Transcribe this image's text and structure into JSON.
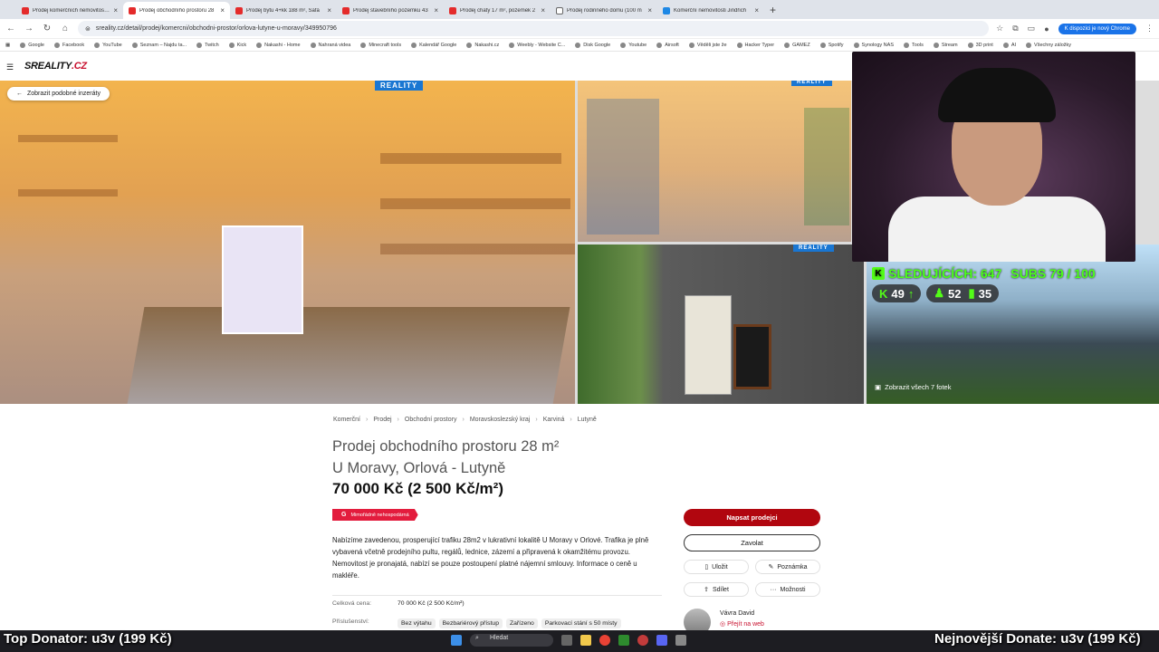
{
  "browser": {
    "tabs": [
      {
        "label": "Prodej komerčních nemovitostí -",
        "active": false,
        "icon": "sreality-favicon"
      },
      {
        "label": "Prodej obchodního prostoru 28",
        "active": true,
        "icon": "sreality-favicon"
      },
      {
        "label": "Prodej bytu 4+kk 188 m², Šafá",
        "active": false,
        "icon": "sreality-favicon"
      },
      {
        "label": "Prodej stavebního pozemku 43",
        "active": false,
        "icon": "sreality-favicon"
      },
      {
        "label": "Prodej chaty 17 m², pozemek 2",
        "active": false,
        "icon": "sreality-favicon"
      },
      {
        "label": "Prodej rodinného domu (100 m",
        "active": false,
        "icon": "document-favicon"
      },
      {
        "label": "Komerční nemovitosti Jindřich",
        "active": false,
        "icon": "blue-favicon"
      }
    ],
    "url": "sreality.cz/detail/prodej/komercni/obchodni-prostor/orlova-lutyne-u-moravy/349950796",
    "promo": "K dispozici je nový Chrome",
    "bookmarks": [
      "Google",
      "Facebook",
      "YouTube",
      "Seznam – Najdu ta...",
      "Twitch",
      "Kick",
      "Nakashi - Home",
      "Nahraná videa",
      "Minecraft tools",
      "Kalendář Google",
      "Nakashi.cz",
      "Weebly - Website C...",
      "Disk Google",
      "Youtube",
      "Airsoft",
      "Věděli jste že",
      "Hacker Typer",
      "GAMEZ",
      "Spotify",
      "Synology NAS",
      "Tools",
      "Stream",
      "3D print",
      "AI",
      "Všechny záložky"
    ]
  },
  "site": {
    "logo_main": "SREALITY",
    "logo_suffix": ".CZ",
    "back_button": "Zobrazit podobné inzeráty",
    "reality_tag": "REALITY",
    "show_all_photos": "Zobrazit všech 7 fotek",
    "breadcrumbs": [
      "Komerční",
      "Prodej",
      "Obchodní prostory",
      "Moravskoslezský kraj",
      "Karviná",
      "Lutyně"
    ],
    "title_line1": "Prodej obchodního prostoru 28 m²",
    "title_line2": "U Moravy, Orlová - Lutyně",
    "price": "70 000 Kč (2 500 Kč/m²)",
    "badge_letter": "G",
    "badge_text": "Mimořádně nehospodárná",
    "description": "Nabízíme zavedenou, prosperující trafiku 28m2 v lukrativní lokalitě U Moravy v Orlové. Trafika je plně vybavená včetně prodejního pultu, regálů, lednice, zázemí a připravená k okamžitému provozu. Nemovitost je pronajatá, nabízí se pouze postoupení platné nájemní smlouvy. Informace o ceně u makléře.",
    "details": {
      "price_label": "Celková cena:",
      "price_value": "70 000 Kč (2 500 Kč/m²)",
      "features_label": "Příslušenství:",
      "features": [
        "Bez výtahu",
        "Bezbariérový přístup",
        "Zařízeno",
        "Parkovací stání s 50 místy"
      ]
    },
    "actions": {
      "message": "Napsat prodejci",
      "call": "Zavolat",
      "save": "Uložit",
      "note": "Poznámka",
      "share": "Sdílet",
      "more": "Možnosti"
    },
    "agent": {
      "name": "Vávra David",
      "link": "Přejít na web"
    }
  },
  "stream": {
    "followers": "SLEDUJÍCÍCH: 647",
    "subs": "SUBS 79 / 100",
    "stat_kick": "49",
    "stat_viewers": "52",
    "stat_chart": "35",
    "top_donator": "Top Donator: u3v (199 Kč)",
    "latest_donate": "Nejnovější Donate: u3v (199 Kč)"
  },
  "taskbar": {
    "search": "Hledat"
  },
  "colors": {
    "brand_red": "#c8102e",
    "primary_button": "#b1060f",
    "kick_green": "#53fc18",
    "chrome_blue": "#1a73e8"
  }
}
